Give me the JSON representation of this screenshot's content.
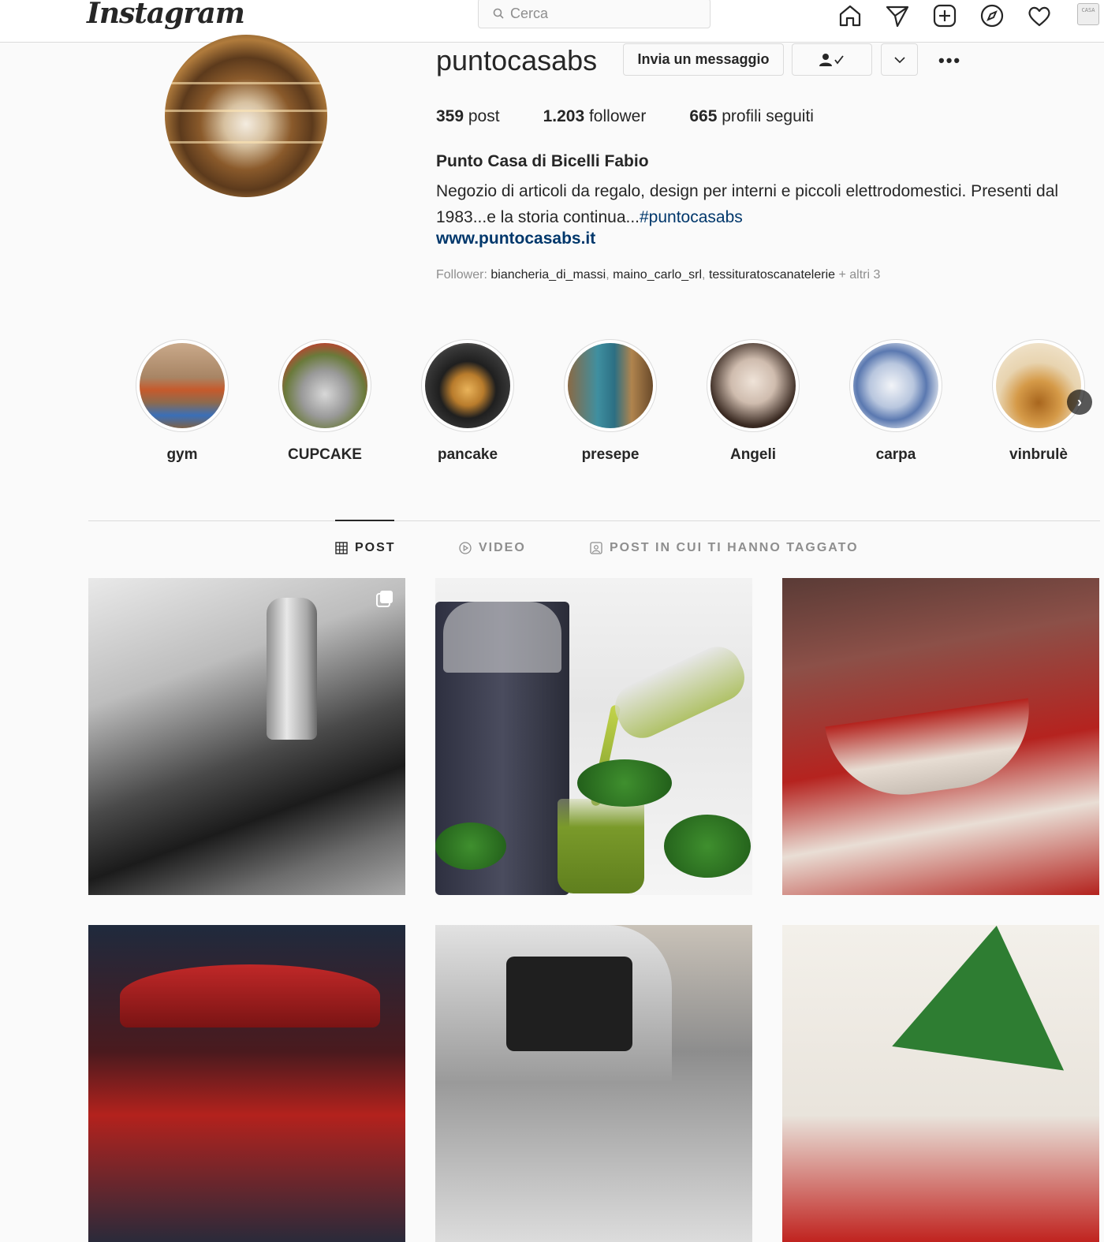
{
  "header": {
    "logo": "Instagram",
    "search_placeholder": "Cerca",
    "nav_icons": [
      "home-icon",
      "direct-icon",
      "new-post-icon",
      "explore-icon",
      "activity-icon",
      "profile-avatar"
    ],
    "avatar_text": "CASA"
  },
  "profile": {
    "username": "puntocasabs",
    "message_button": "Invia un messaggio",
    "stats": {
      "posts_count": "359",
      "posts_label": " post",
      "followers_count": "1.203",
      "followers_label": " follower",
      "following_count": "665",
      "following_label": " profili seguiti"
    },
    "full_name": "Punto Casa di Bicelli Fabio",
    "bio_text": "Negozio di articoli da regalo, design per interni e piccoli elettrodomestici. Presenti dal 1983...e la storia continua...",
    "bio_hashtag": "#puntocasabs",
    "website": "www.puntocasabs.it",
    "followed_by_label": "Follower: ",
    "followed_by": [
      "biancheria_di_massi",
      "maino_carlo_srl",
      "tessituratoscanatelerie"
    ],
    "followed_by_more": " + altri 3"
  },
  "highlights": [
    {
      "label": "gym"
    },
    {
      "label": "CUPCAKE"
    },
    {
      "label": "pancake"
    },
    {
      "label": "presepe"
    },
    {
      "label": "Angeli"
    },
    {
      "label": "carpa"
    },
    {
      "label": "vinbrulè"
    }
  ],
  "tabs": [
    {
      "label": "POST",
      "active": true
    },
    {
      "label": "VIDEO",
      "active": false
    },
    {
      "label": "POST IN CUI TI HANNO TAGGATO",
      "active": false
    }
  ],
  "colors": {
    "link": "#00376b",
    "text": "#262626",
    "secondary": "#8e8e8e",
    "border": "#dbdbdb"
  }
}
